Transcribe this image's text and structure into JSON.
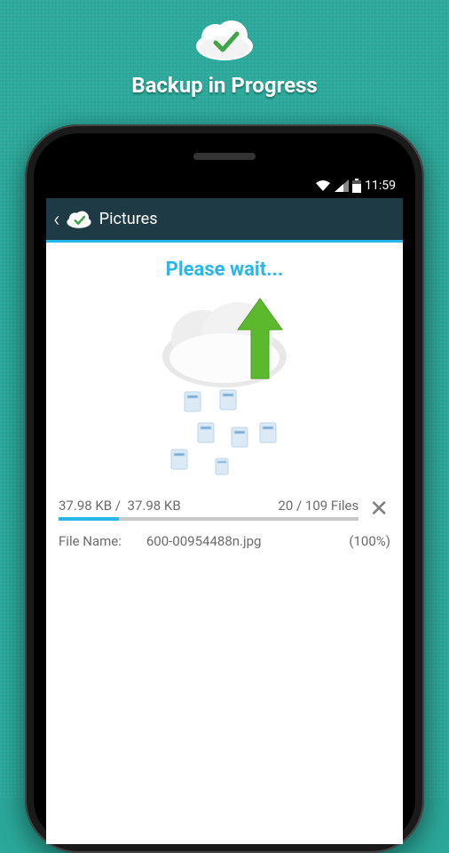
{
  "promo": {
    "title": "Backup in Progress"
  },
  "statusbar": {
    "time": "11:59"
  },
  "appbar": {
    "title": "Pictures"
  },
  "main": {
    "wait_label": "Please wait...",
    "size_done": "37.98 KB",
    "size_total": "37.98 KB",
    "files_done": "20",
    "files_total": "109 Files",
    "progress_percent": 20,
    "file_label": "File Name:",
    "file_name": "600-00954488n.jpg",
    "file_percent": "(100%)"
  }
}
